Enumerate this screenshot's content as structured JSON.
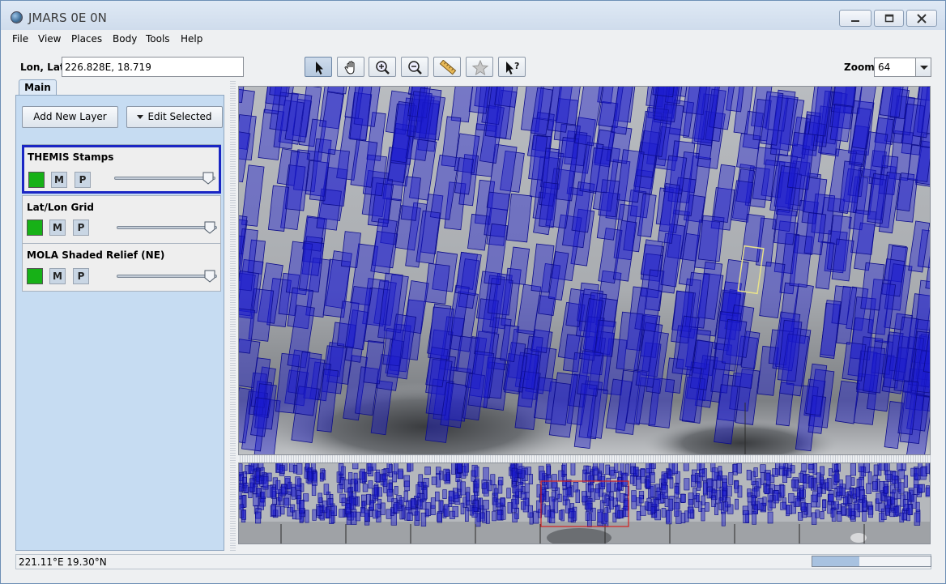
{
  "window": {
    "title": "JMARS 0E 0N"
  },
  "menu": [
    "File",
    "View",
    "Places",
    "Body",
    "Tools",
    "Help"
  ],
  "location": {
    "label": "Lon, Lat",
    "value": "226.828E, 18.719"
  },
  "toolbar": {
    "tools": [
      "select-tool",
      "pan-tool",
      "zoom-in-tool",
      "zoom-out-tool",
      "measure-tool",
      "spot-tool",
      "investigate-tool"
    ],
    "active_tool": "select-tool"
  },
  "zoom": {
    "label": "Zoom:",
    "value": "64"
  },
  "tabs": {
    "main": "Main"
  },
  "panel": {
    "add_layer": "Add New Layer",
    "edit_selected": "Edit Selected"
  },
  "layers": [
    {
      "name": "THEMIS Stamps",
      "color": "#17b117",
      "m": "M",
      "p": "P",
      "opacity": 1.0,
      "selected": true
    },
    {
      "name": "Lat/Lon Grid",
      "color": "#17b117",
      "m": "M",
      "p": "P",
      "opacity": 1.0,
      "selected": false
    },
    {
      "name": "MOLA Shaded Relief (NE)",
      "color": "#17b117",
      "m": "M",
      "p": "P",
      "opacity": 1.0,
      "selected": false
    }
  ],
  "status": {
    "coords": "221.11°E   19.30°N",
    "progress": 0.4
  },
  "colors": {
    "stamp_fill": "#1a1ad0",
    "stamp_edge": "#0c0c8a",
    "selection": "#e8e28a",
    "overview_box": "#d42020"
  }
}
